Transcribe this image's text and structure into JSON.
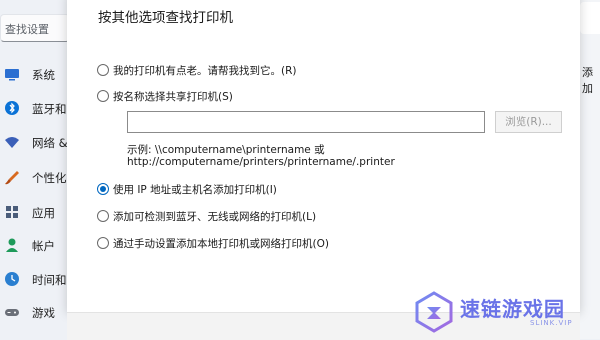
{
  "settings": {
    "search_placeholder": "查找设置",
    "nav": [
      {
        "label": "系统",
        "icon": "monitor-icon",
        "color": "#2b6fd1"
      },
      {
        "label": "蓝牙和",
        "icon": "bluetooth-icon",
        "color": "#0a72d6"
      },
      {
        "label": "网络 &",
        "icon": "wifi-icon",
        "color": "#3a5fb8"
      },
      {
        "label": "个性化",
        "icon": "brush-icon",
        "color": "#d86a1f"
      },
      {
        "label": "应用",
        "icon": "apps-icon",
        "color": "#4a5d7a"
      },
      {
        "label": "帐户",
        "icon": "account-icon",
        "color": "#1e9a5a"
      },
      {
        "label": "时间和",
        "icon": "clock-globe-icon",
        "color": "#2a7fd0"
      },
      {
        "label": "游戏",
        "icon": "gamepad-icon",
        "color": "#6a6f78"
      }
    ],
    "right_edge_text": "添加"
  },
  "dialog": {
    "title": "按其他选项查找打印机",
    "options": [
      {
        "label": "我的打印机有点老。请帮我找到它。(R)",
        "checked": false
      },
      {
        "label": "按名称选择共享打印机(S)",
        "checked": false
      },
      {
        "label": "使用 IP 地址或主机名添加打印机(I)",
        "checked": true
      },
      {
        "label": "添加可检测到蓝牙、无线或网络的打印机(L)",
        "checked": false
      },
      {
        "label": "通过手动设置添加本地打印机或网络打印机(O)",
        "checked": false
      }
    ],
    "share_name_value": "",
    "browse_label": "浏览(R)...",
    "example_line1": "示例: \\\\computername\\printername 或",
    "example_line2": "http://computername/printers/printername/.printer"
  },
  "watermark": {
    "title": "速链游戏园",
    "subtitle": "SLINK.VIP"
  }
}
